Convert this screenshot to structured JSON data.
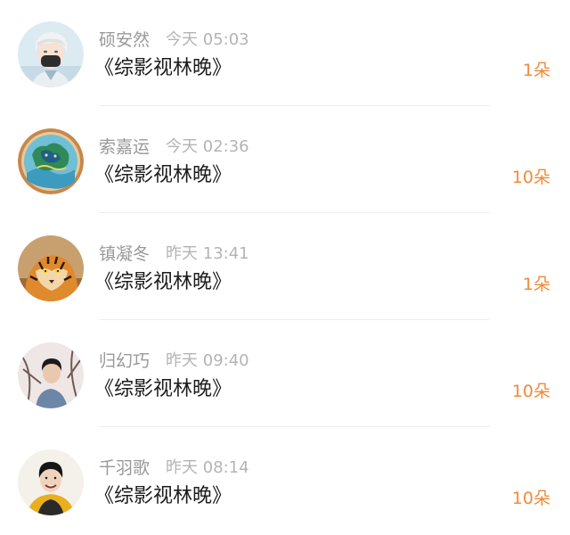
{
  "items": [
    {
      "name": "硕安然",
      "time": "今天 05:03",
      "title": "《综影视林晚》",
      "count": "1朵",
      "avatar": "avatar-masked-boy-icon"
    },
    {
      "name": "索嘉运",
      "time": "今天 02:36",
      "title": "《综影视林晚》",
      "count": "10朵",
      "avatar": "avatar-tiger-emblem-icon"
    },
    {
      "name": "镇凝冬",
      "time": "昨天 13:41",
      "title": "《综影视林晚》",
      "count": "1朵",
      "avatar": "avatar-tiger-icon"
    },
    {
      "name": "归幻巧",
      "time": "昨天 09:40",
      "title": "《综影视林晚》",
      "count": "10朵",
      "avatar": "avatar-person-photo-icon"
    },
    {
      "name": "千羽歌",
      "time": "昨天 08:14",
      "title": "《综影视林晚》",
      "count": "10朵",
      "avatar": "avatar-smiling-person-icon"
    }
  ],
  "colors": {
    "accent": "#f08a3a",
    "name": "#999999",
    "time": "#b4b4b4",
    "title": "#1c1c1c"
  }
}
